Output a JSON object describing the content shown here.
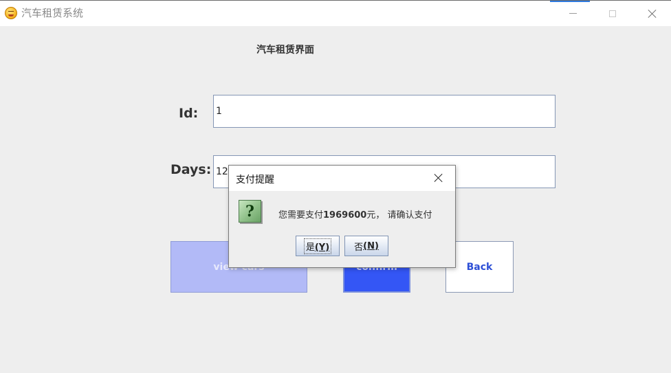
{
  "window": {
    "title": "汽车租赁系统",
    "icon": "emoji-face-icon"
  },
  "main": {
    "heading": "汽车租赁界面",
    "id_label": "Id:",
    "id_value": "1",
    "days_label": "Days:",
    "days_value": "123",
    "buttons": {
      "view_cars": "view cars",
      "confirm": "confirm",
      "back": "Back"
    }
  },
  "dialog": {
    "title": "支付提醒",
    "icon": "question-icon",
    "message_prefix": "您需要支付",
    "amount": "1969600",
    "message_suffix": "元， 请确认支付",
    "yes_label": "是",
    "yes_mnemonic": "(Y)",
    "no_label": "否",
    "no_mnemonic": "(N)"
  },
  "colors": {
    "view_button_bg": "#b2baf7",
    "confirm_button_bg": "#3456f5",
    "back_text": "#2d4fd6"
  }
}
